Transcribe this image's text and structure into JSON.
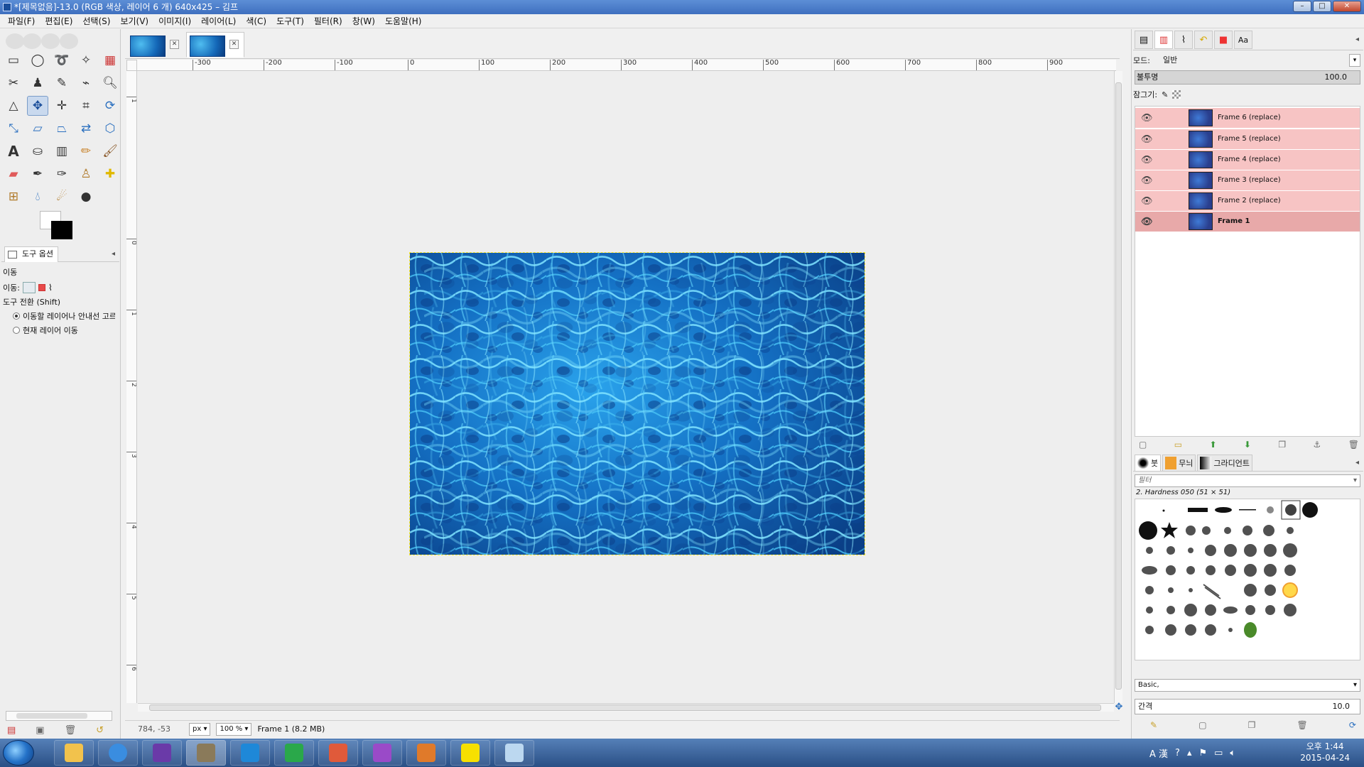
{
  "window": {
    "title": "*[제목없음]-13.0 (RGB 색상, 레이어 6 개) 640x425 – 김프",
    "min_icon": "minimize-icon",
    "max_icon": "maximize-icon",
    "close_icon": "close-icon"
  },
  "menu": {
    "items": [
      "파일(F)",
      "편집(E)",
      "선택(S)",
      "보기(V)",
      "이미지(I)",
      "레이어(L)",
      "색(C)",
      "도구(T)",
      "필터(R)",
      "창(W)",
      "도움말(H)"
    ]
  },
  "toolbox": {
    "tools": [
      "rect-select",
      "ellipse-select",
      "free-select",
      "fuzzy-select",
      "color-select",
      "scissors-select",
      "foreground-select",
      "paths",
      "color-picker",
      "zoom",
      "measure",
      "move",
      "align",
      "crop",
      "rotate",
      "scale",
      "shear",
      "perspective",
      "flip",
      "cage-transform",
      "text",
      "bucket-fill",
      "blend",
      "pencil",
      "paintbrush",
      "eraser",
      "airbrush",
      "ink",
      "clone",
      "heal",
      "perspective-clone",
      "blur-sharpen",
      "smudge"
    ],
    "active_tool": "move",
    "options_tab_label": "도구 옵션",
    "options": {
      "section_title": "이동",
      "mode_label": "이동:",
      "switch_label": "도구 전환 (Shift)",
      "radio1": "이동할 레이어나 안내선 고르기",
      "radio2": "현재 레이어 이동"
    }
  },
  "canvas": {
    "ruler_h": [
      "-300",
      "-200",
      "-100",
      "0",
      "100",
      "200",
      "300",
      "400",
      "500",
      "600",
      "700",
      "800",
      "900"
    ],
    "ruler_v": [
      "1",
      "0",
      "1",
      "2",
      "3",
      "4",
      "5",
      "6"
    ],
    "image_size": "640x425"
  },
  "statusbar": {
    "coords": "784, -53",
    "unit": "px",
    "zoom": "100 %",
    "info": "Frame 1 (8.2 MB)"
  },
  "layers": {
    "mode_label": "모드:",
    "mode_value": "일반",
    "opacity_label": "불투명",
    "opacity_value": "100.0",
    "lock_label": "잠그기:",
    "items": [
      {
        "name": "Frame 6 (replace)",
        "selected": false
      },
      {
        "name": "Frame 5 (replace)",
        "selected": false
      },
      {
        "name": "Frame 4 (replace)",
        "selected": false
      },
      {
        "name": "Frame 3 (replace)",
        "selected": false
      },
      {
        "name": "Frame 2 (replace)",
        "selected": false
      },
      {
        "name": "Frame 1",
        "selected": true
      }
    ],
    "row_color": "#f7c4c4",
    "selected_row_color": "#e8a9a9"
  },
  "brushes": {
    "tabs": [
      "붓",
      "무늬",
      "그라디언트"
    ],
    "filter_placeholder": "필터",
    "current_brush": "2. Hardness 050 (51 × 51)",
    "preset": "Basic,",
    "spacing_label": "간격",
    "spacing_value": "10.0"
  },
  "taskbar": {
    "apps": [
      "file-explorer",
      "internet-explorer",
      "visual-studio",
      "gimp",
      "hancom-word",
      "hancom-cell",
      "hancom-show",
      "onenote",
      "ibooks",
      "kakaotalk",
      "paint"
    ],
    "tray_lang": "A 漢",
    "time": "오후 1:44",
    "date": "2015-04-24"
  },
  "colors": {
    "foreground": "#ffffff",
    "background": "#000000",
    "water_accent": "#1a7fd6"
  }
}
